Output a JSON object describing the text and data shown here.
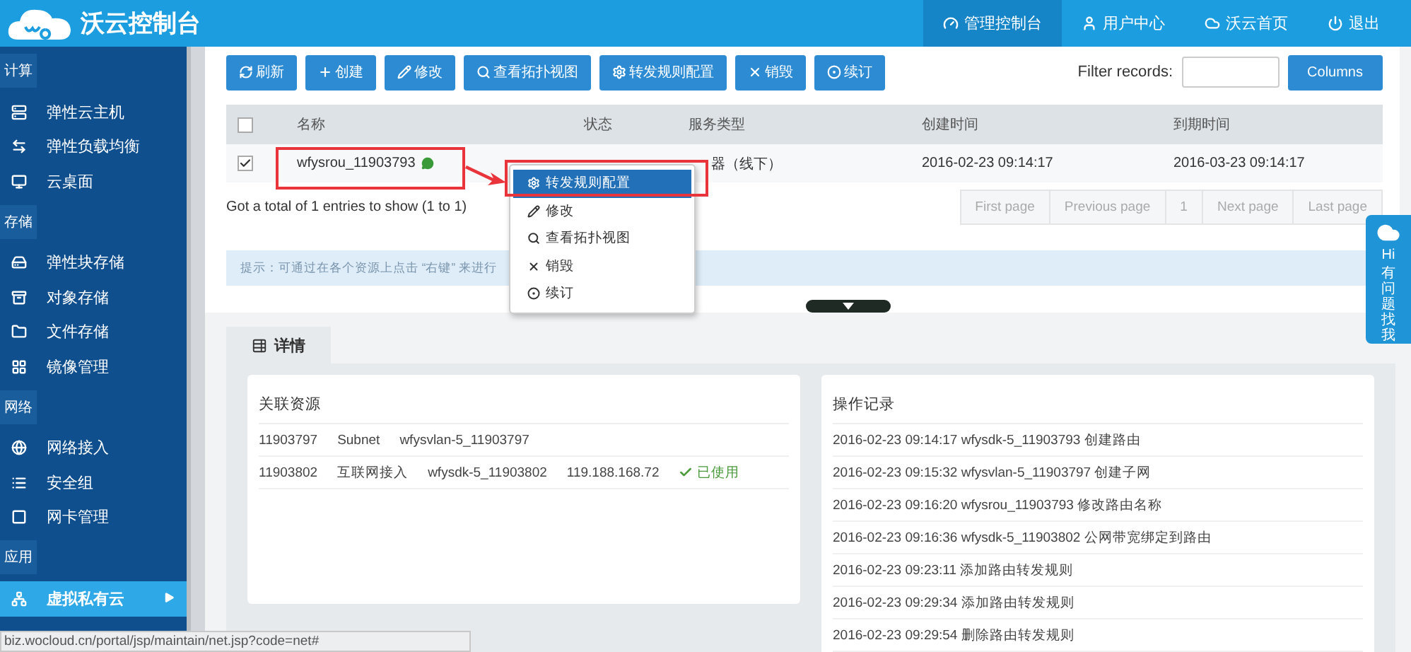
{
  "header": {
    "title": "沃云控制台",
    "nav": [
      {
        "label": "管理控制台",
        "kind": "dashboard",
        "selected": true
      },
      {
        "label": "用户中心",
        "kind": "user",
        "selected": false
      },
      {
        "label": "沃云首页",
        "kind": "cloud",
        "selected": false
      },
      {
        "label": "退出",
        "kind": "power",
        "selected": false
      }
    ]
  },
  "sidebar": {
    "sections": [
      {
        "title": "计算",
        "items": [
          {
            "label": "弹性云主机",
            "kind": "server",
            "selected": false
          },
          {
            "label": "弹性负载均衡",
            "kind": "swap",
            "selected": false
          },
          {
            "label": "云桌面",
            "kind": "monitor",
            "selected": false
          }
        ]
      },
      {
        "title": "存储",
        "items": [
          {
            "label": "弹性块存储",
            "kind": "drive",
            "selected": false
          },
          {
            "label": "对象存储",
            "kind": "archive",
            "selected": false
          },
          {
            "label": "文件存储",
            "kind": "folder",
            "selected": false
          },
          {
            "label": "镜像管理",
            "kind": "grid",
            "selected": false
          }
        ]
      },
      {
        "title": "网络",
        "items": [
          {
            "label": "网络接入",
            "kind": "globe",
            "selected": false
          },
          {
            "label": "安全组",
            "kind": "list",
            "selected": false
          },
          {
            "label": "网卡管理",
            "kind": "square",
            "selected": false
          }
        ]
      },
      {
        "title": "应用",
        "items": [
          {
            "label": "虚拟私有云",
            "kind": "network",
            "selected": true
          }
        ]
      }
    ]
  },
  "toolbar": {
    "buttons": [
      {
        "label": "刷新",
        "kind": "refresh"
      },
      {
        "label": "创建",
        "kind": "plus"
      },
      {
        "label": "修改",
        "kind": "pencil"
      },
      {
        "label": "查看拓扑视图",
        "kind": "search"
      },
      {
        "label": "转发规则配置",
        "kind": "gear"
      },
      {
        "label": "销毁",
        "kind": "cross"
      },
      {
        "label": "续订",
        "kind": "circle"
      }
    ],
    "filter_label": "Filter records:",
    "columns_button": "Columns"
  },
  "table": {
    "header_checked": false,
    "columns": [
      "名称",
      "状态",
      "服务类型",
      "创建时间",
      "到期时间"
    ],
    "rows": [
      {
        "checked": true,
        "name": "wfysrou_11903793",
        "service_type": "器（线下）",
        "created": "2016-02-23 09:14:17",
        "expires": "2016-03-23 09:14:17"
      }
    ]
  },
  "summary": "Got a total of 1 entries to show (1 to 1)",
  "pagination": [
    "First page",
    "Previous page",
    "1",
    "Next page",
    "Last page"
  ],
  "hint": "提示：可通过在各个资源上点击 “右键” 来进行",
  "context_menu": [
    {
      "label": "转发规则配置",
      "kind": "gear",
      "selected": true
    },
    {
      "label": "修改",
      "kind": "pencil",
      "selected": false
    },
    {
      "label": "查看拓扑视图",
      "kind": "search",
      "selected": false
    },
    {
      "label": "销毁",
      "kind": "cross",
      "selected": false
    },
    {
      "label": "续订",
      "kind": "circle",
      "selected": false
    }
  ],
  "detail_tabs": [
    {
      "label": "详情",
      "selected": true
    }
  ],
  "related": {
    "title": "关联资源",
    "rows": [
      {
        "cells": [
          "11903797",
          "Subnet",
          "wfysvlan-5_11903797"
        ]
      },
      {
        "cells": [
          "11903802",
          "互联网接入",
          "wfysdk-5_11903802",
          "119.188.168.72"
        ],
        "status": "已使用"
      }
    ]
  },
  "log": {
    "title": "操作记录",
    "entries": [
      "2016-02-23 09:14:17 wfysdk-5_11903793 创建路由",
      "2016-02-23 09:15:32 wfysvlan-5_11903797 创建子网",
      "2016-02-23 09:16:20 wfysrou_11903793 修改路由名称",
      "2016-02-23 09:16:36 wfysdk-5_11903802 公网带宽绑定到路由",
      "2016-02-23 09:23:11 添加路由转发规则",
      "2016-02-23 09:29:34 添加路由转发规则",
      "2016-02-23 09:29:54 删除路由转发规则"
    ]
  },
  "help_widget": {
    "greeting": "Hi",
    "text": "有问题找我"
  },
  "status_url": "biz.wocloud.cn/portal/jsp/maintain/net.jsp?code=net#"
}
